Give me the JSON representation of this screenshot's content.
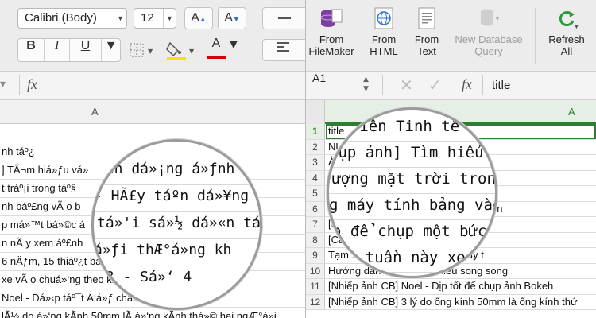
{
  "left": {
    "font_name": "Calibri (Body)",
    "font_size": "12",
    "grow_label": "A",
    "shrink_label": "A",
    "bold": "B",
    "italic": "I",
    "underline": "U",
    "fill_letter": "A",
    "fx_label": "fx",
    "column_letter": "A",
    "rows": [
      "nh táº¿",
      "] TÃ¬m hiá»ƒu vá»",
      "t tráº¡i trong táº§",
      "nh báº£ng vÃ o b",
      "p má»™t bá»©c á",
      "n nÃ y xem áº£nh",
      "6 nÄƒm, 15 thiáº¿t bá»",
      "xe vÃ o chuá»‘ng theo ki",
      "Noel - Dá»‹p táº¯t Ä‘á»ƒ chá»¥p áº£nh Bokeh",
      "lÃ½ do á»‘ng kÃ­nh 50mm lÃ  á»‘ng kÃ­nh thá»© hai ngÆ°á»i"
    ],
    "lens_lines": [
      "ính dá»¡ng á»ƒnh R",
      "- HÃ£y táº­n dá»¥ng",
      "tá»'i sá»½ dá»«n tá»›",
      "á»ƒi thÆ°á»ng kh",
      "i? - Sá»‘ 4"
    ]
  },
  "right": {
    "buttons": [
      {
        "label1": "From",
        "label2": "FileMaker"
      },
      {
        "label1": "From",
        "label2": "HTML"
      },
      {
        "label1": "From",
        "label2": "Text"
      },
      {
        "label1": "New Database",
        "label2": "Query"
      },
      {
        "label1": "Refresh",
        "label2": "All"
      }
    ],
    "cell_ref": "A1",
    "fx_label": "fx",
    "formula_value": "title",
    "column_letter": "A",
    "rows": [
      {
        "n": "1",
        "text": "title"
      },
      {
        "n": "2",
        "text": "NULL"
      },
      {
        "n": "3",
        "text": "Ảnh"
      },
      {
        "n": "4",
        "text": "[Nhiếp ảnh CB] dạng ảnh Raw"
      },
      {
        "n": "5",
        "text": "[Nhiếp ảnh CB] - Hãy tận dụng"
      },
      {
        "n": "6",
        "text": "[Nhiếp ảnh CB] tới sẽ dẫn tới chứng n"
      },
      {
        "n": "7",
        "text": "[Nhiếp ảnh CB] thường không thườ"
      },
      {
        "n": "8",
        "text": "[Ca] ... của ai? - Số 4"
      },
      {
        "n": "9",
        "text": "Tạm ... hiết bị và nỗ lực cho thấy t"
      },
      {
        "n": "10",
        "text": "Hướng dẫn ... ồng theo kiểu song song"
      },
      {
        "n": "11",
        "text": "[Nhiếp ảnh CB] Noel - Dịp tốt để chụp ảnh Bokeh"
      },
      {
        "n": "12",
        "text": "[Nhiếp ảnh CB] 3 lý do ống kính 50mm là ống kính thứ"
      }
    ],
    "lens_lines": [
      "i viên Tinh tế",
      "hụp ảnh] Tìm hiểu v",
      "ượng mặt trời trong t",
      "g máy tính bảng vào",
      "o để chụp một bức",
      "Đầu tuần này xe"
    ]
  },
  "colors": {
    "active_cell_border": "#2e7d32",
    "fill_bar": "#f2e600",
    "font_bar": "#d80000",
    "db_icon": "#7a3fa0",
    "refresh_icon": "#2c9a3a"
  }
}
